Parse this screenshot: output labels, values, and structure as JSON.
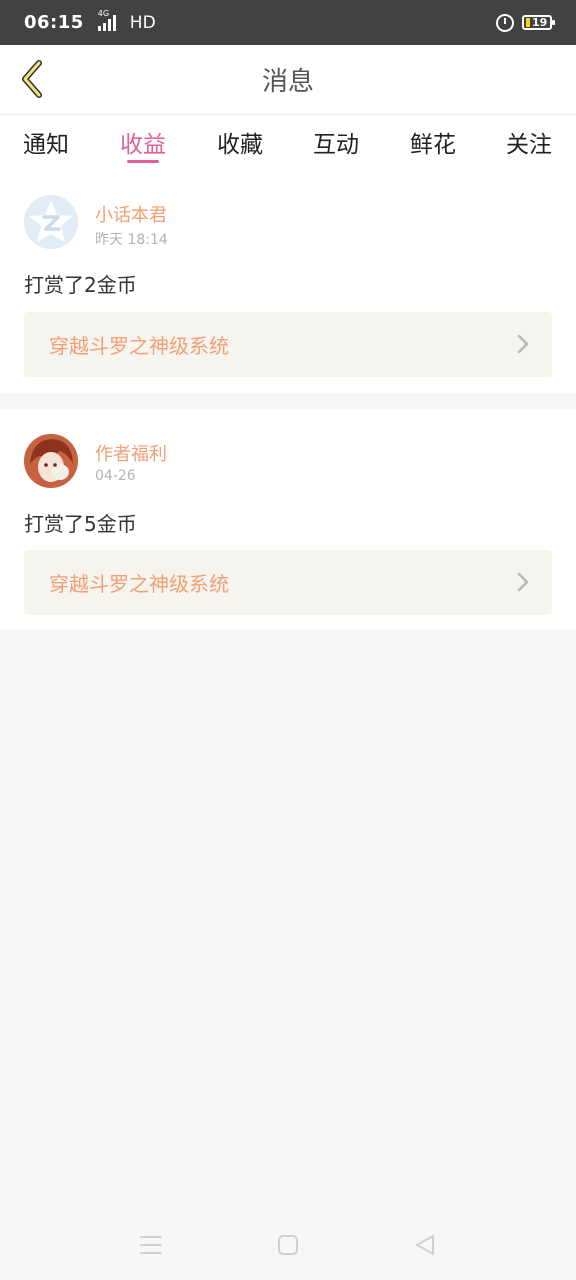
{
  "status": {
    "time": "06:15",
    "network": "4G",
    "hd": "HD",
    "battery": "19"
  },
  "header": {
    "title": "消息"
  },
  "tabs": [
    {
      "label": "通知"
    },
    {
      "label": "收益"
    },
    {
      "label": "收藏"
    },
    {
      "label": "互动"
    },
    {
      "label": "鲜花"
    },
    {
      "label": "关注"
    }
  ],
  "active_tab": "收益",
  "messages": [
    {
      "sender": "小话本君",
      "time": "昨天 18:14",
      "text": "打赏了2金币",
      "book": "穿越斗罗之神级系统"
    },
    {
      "sender": "作者福利",
      "time": "04-26",
      "text": "打赏了5金币",
      "book": "穿越斗罗之神级系统"
    }
  ],
  "colors": {
    "accent": "#e0609a",
    "orange": "#f0a073",
    "status_bar": "#424242"
  }
}
